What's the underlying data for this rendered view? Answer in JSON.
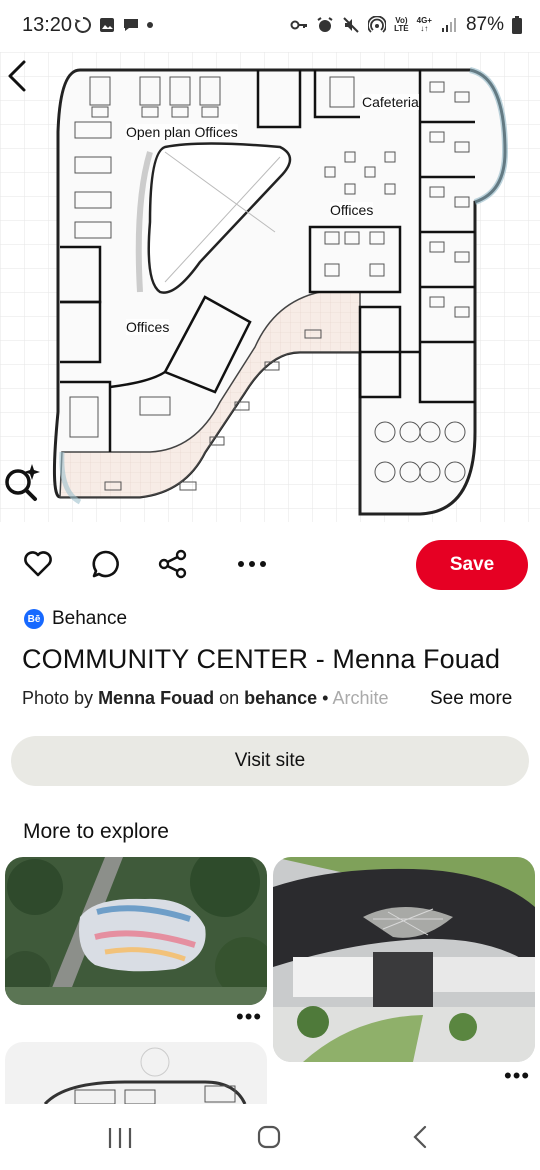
{
  "status_bar": {
    "time": "13:20",
    "network_top": "Vo)",
    "network_bottom": "LTE",
    "signal_top": "4G+",
    "battery": "87%"
  },
  "hero": {
    "labels": {
      "cafeteria": "Cafeteria",
      "open_plan": "Open plan Offices",
      "offices_right": "Offices",
      "offices_left": "Offices"
    }
  },
  "actions": {
    "save_label": "Save"
  },
  "pin": {
    "source": "Behance",
    "source_badge": "Bē",
    "title": "COMMUNITY CENTER - Menna Fouad",
    "byline_prefix": "Photo by ",
    "author": "Menna Fouad",
    "on_text": " on ",
    "platform": "behance",
    "separator": " • ",
    "category_truncated": "Archite",
    "see_more": "See more",
    "visit_label": "Visit site"
  },
  "explore": {
    "title": "More to explore",
    "more_dots": "•••"
  },
  "colors": {
    "save": "#e60023",
    "visit_bg": "#e9e9e4",
    "behance": "#1769ff"
  }
}
